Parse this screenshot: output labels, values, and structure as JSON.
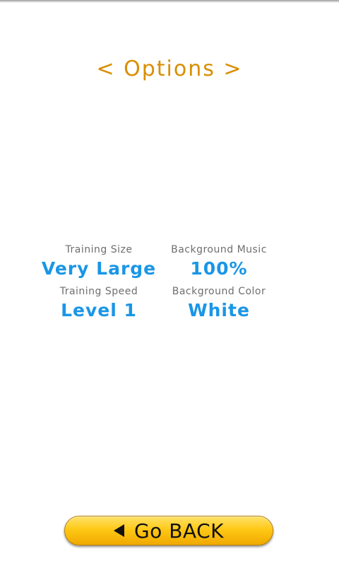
{
  "header": {
    "title": "< Options >"
  },
  "options": {
    "training_size": {
      "label": "Training Size",
      "value": "Very Large"
    },
    "background_music": {
      "label": "Background Music",
      "value": "100%"
    },
    "training_speed": {
      "label": "Training Speed",
      "value": "Level 1"
    },
    "background_color": {
      "label": "Background Color",
      "value": "White"
    }
  },
  "footer": {
    "back_label": "Go BACK",
    "back_icon": "back-arrow-icon"
  },
  "colors": {
    "title": "#d98e00",
    "value": "#1a96e6",
    "label": "#6e6e6e",
    "button": "#ffc916"
  }
}
